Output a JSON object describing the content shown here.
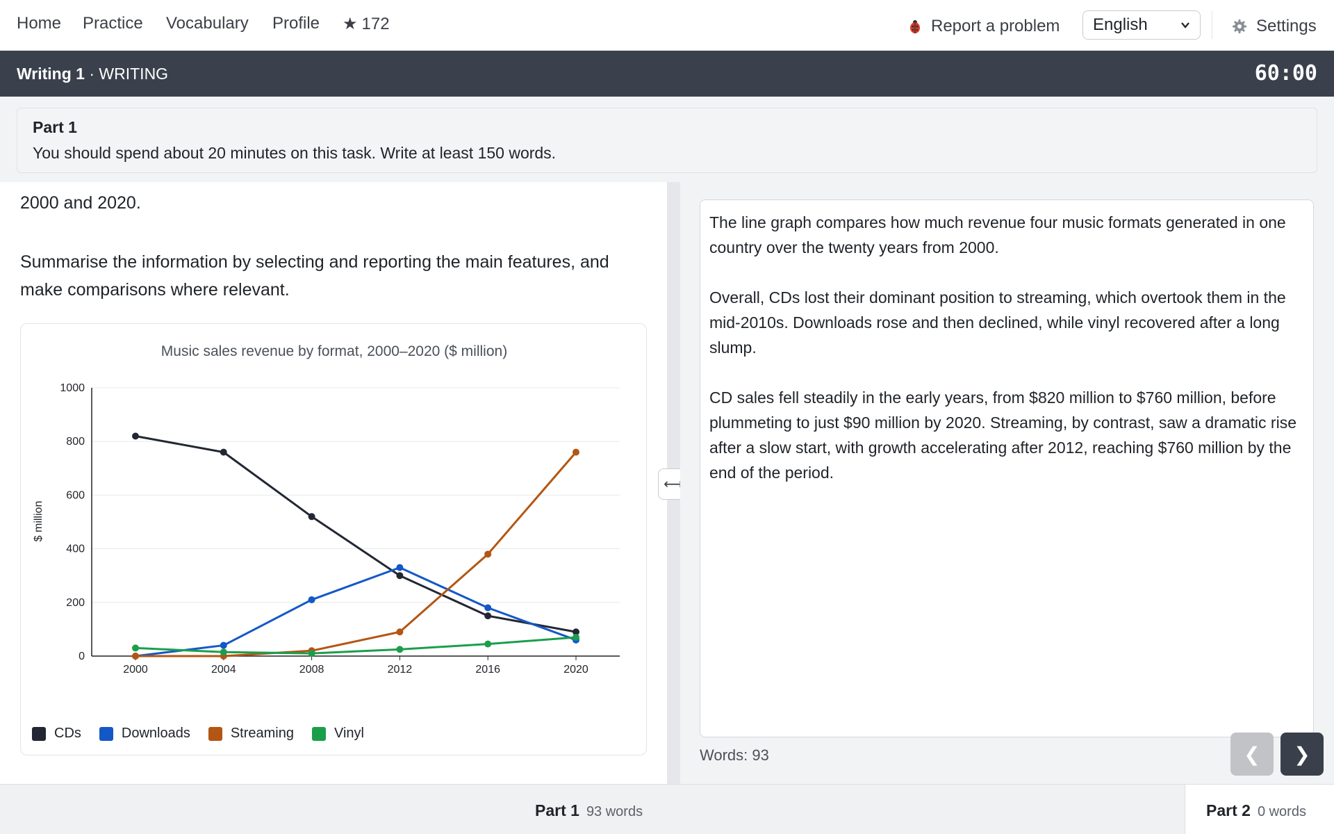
{
  "nav": {
    "home": "Home",
    "practice": "Practice",
    "vocabulary": "Vocabulary",
    "profile": "Profile",
    "stars": "172",
    "report": "Report a problem",
    "language": "English",
    "settings": "Settings"
  },
  "test": {
    "name": "Writing 1",
    "separator": "·",
    "section": "WRITING",
    "timer": "60:00"
  },
  "part": {
    "title": "Part 1",
    "instructions": "You should spend about 20 minutes on this task. Write at least 150 words."
  },
  "task": {
    "clipped_line": "2000 and 2020.",
    "summary": "Summarise the information by selecting and reporting the main features, and make comparisons where relevant."
  },
  "chart_data": {
    "type": "line",
    "title": "Music sales revenue by format, 2000–2020 ($ million)",
    "xlabel": "",
    "ylabel": "$ million",
    "x": [
      2000,
      2004,
      2008,
      2012,
      2016,
      2020
    ],
    "x_tick_labels": [
      "2000",
      "2004",
      "2008",
      "2012",
      "2016",
      "2020"
    ],
    "ylim": [
      0,
      1000
    ],
    "y_ticks": [
      0,
      200,
      400,
      600,
      800,
      1000
    ],
    "y_tick_labels": [
      "0",
      "200",
      "400",
      "600",
      "800",
      "1000"
    ],
    "grid": true,
    "legend": "bottom-left",
    "series": [
      {
        "name": "CDs",
        "color": "#222733",
        "values": [
          820,
          760,
          520,
          300,
          150,
          90
        ]
      },
      {
        "name": "Downloads",
        "color": "#1458c7",
        "values": [
          0,
          40,
          210,
          330,
          180,
          60
        ]
      },
      {
        "name": "Streaming",
        "color": "#b35613",
        "values": [
          0,
          0,
          20,
          90,
          380,
          760
        ]
      },
      {
        "name": "Vinyl",
        "color": "#1b9e4b",
        "values": [
          30,
          15,
          10,
          25,
          45,
          70
        ]
      }
    ]
  },
  "answer": {
    "paragraphs": [
      "The line graph compares how much revenue four music formats generated in one country over the twenty years from 2000.",
      "Overall, CDs lost their dominant position to streaming, which overtook them in the mid-2010s. Downloads rose and then declined, while vinyl recovered after a long slump.",
      "CD sales fell steadily in the early years, from $820 million to $760 million, before plummeting to just $90 million by 2020. Streaming, by contrast, saw a dramatic rise after a slow start, with growth accelerating after 2012, reaching $760 million by the end of the period."
    ],
    "word_count": "Words: 93"
  },
  "controls": {
    "splitter": "⟷",
    "prev": "❮",
    "next": "❯"
  },
  "footer": {
    "part1_label": "Part 1",
    "part1_words": "93 words",
    "part2_label": "Part 2",
    "part2_words": "0 words"
  }
}
